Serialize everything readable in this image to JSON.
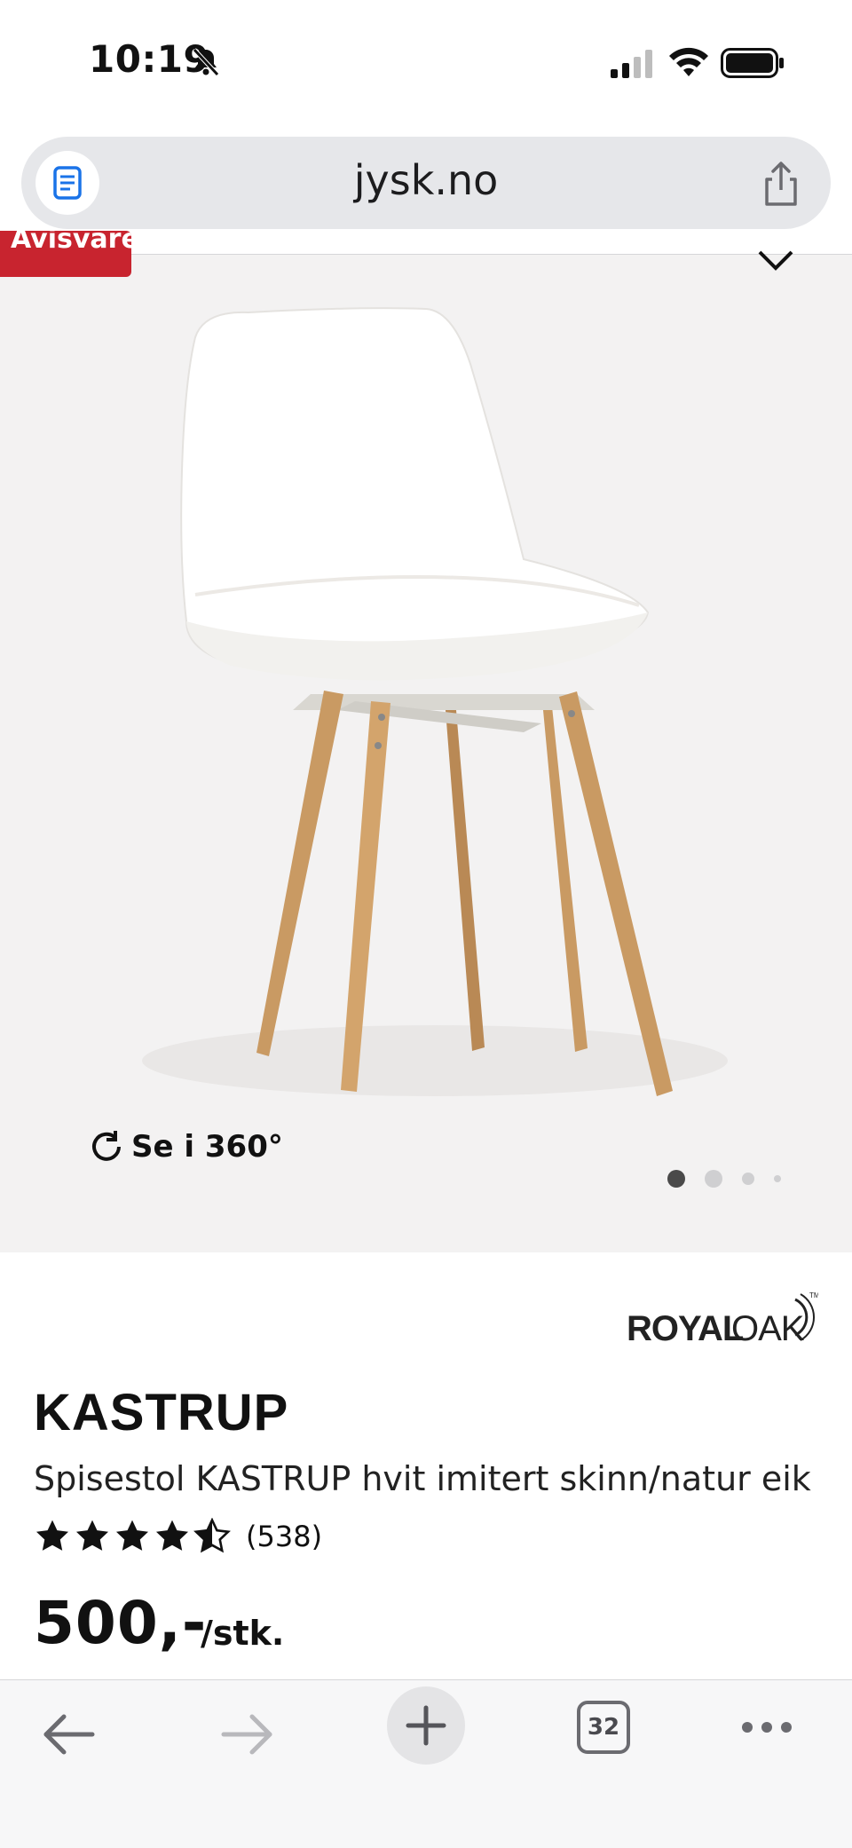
{
  "status_bar": {
    "time": "10:19"
  },
  "browser": {
    "url": "jysk.no"
  },
  "product": {
    "badge": "Avisvare",
    "view_360_label": "Se i 360°",
    "gallery_dots": 4,
    "brand_logo": "ROYALOAK",
    "title": "KASTRUP",
    "subtitle": "Spisestol KASTRUP hvit imitert skinn/natur eik",
    "rating": 4.5,
    "review_count": "(538)",
    "price": "500,-",
    "unit": "/stk."
  },
  "toolbar": {
    "tab_count": "32"
  },
  "colors": {
    "badge": "#c8242f",
    "hero_bg": "#f3f2f2",
    "wood": "#c99a63"
  }
}
